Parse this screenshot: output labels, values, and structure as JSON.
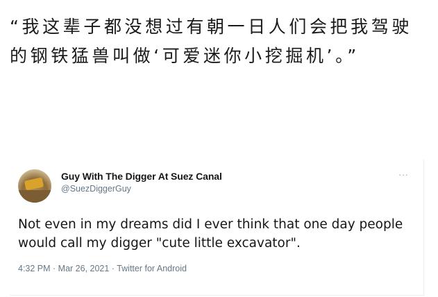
{
  "caption": {
    "text": "“我这辈子都没想过有朝一日人们会把我驾驶的钢铁猛兽叫做‘可爱迷你小挖掘机’。”"
  },
  "tweet": {
    "author_name": "Guy With The Digger At Suez Canal",
    "handle": "@SuezDiggerGuy",
    "more_label": "···",
    "text": "Not even in my dreams did I ever think that one day people would call my digger \"cute little excavator\".",
    "timestamp": "4:32 PM · Mar 26, 2021 · Twitter for Android",
    "avatar_icon": "excavator-photo-icon"
  }
}
